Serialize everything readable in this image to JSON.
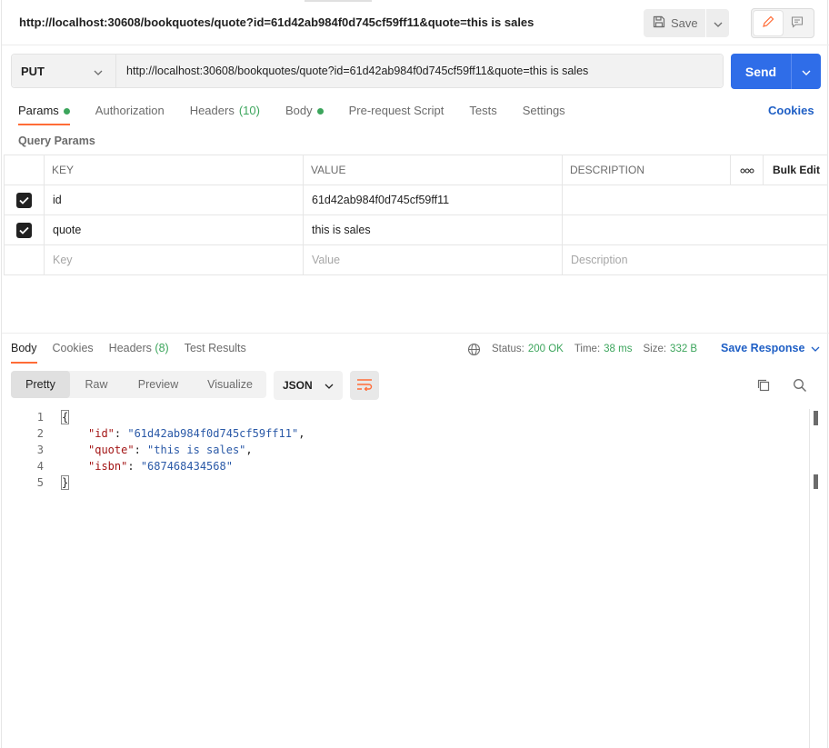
{
  "request": {
    "title": "http://localhost:30608/bookquotes/quote?id=61d42ab984f0d745cf59ff11&quote=this is sales",
    "method": "PUT",
    "url": "http://localhost:30608/bookquotes/quote?id=61d42ab984f0d745cf59ff11&quote=this is sales",
    "save_label": "Save",
    "send_label": "Send"
  },
  "request_tabs": [
    {
      "label": "Params",
      "active": true,
      "dot": true
    },
    {
      "label": "Authorization"
    },
    {
      "label": "Headers",
      "count": "(10)"
    },
    {
      "label": "Body",
      "dot": true
    },
    {
      "label": "Pre-request Script"
    },
    {
      "label": "Tests"
    },
    {
      "label": "Settings"
    }
  ],
  "cookies_label": "Cookies",
  "query_params": {
    "section_label": "Query Params",
    "columns": {
      "key": "KEY",
      "value": "VALUE",
      "description": "DESCRIPTION",
      "more": "ooo",
      "bulk_edit": "Bulk Edit"
    },
    "rows": [
      {
        "checked": true,
        "key": "id",
        "value": "61d42ab984f0d745cf59ff11",
        "description": ""
      },
      {
        "checked": true,
        "key": "quote",
        "value": "this is sales",
        "description": ""
      }
    ],
    "placeholders": {
      "key": "Key",
      "value": "Value",
      "description": "Description"
    }
  },
  "response": {
    "tabs": [
      {
        "label": "Body",
        "active": true
      },
      {
        "label": "Cookies"
      },
      {
        "label": "Headers",
        "count": "(8)"
      },
      {
        "label": "Test Results"
      }
    ],
    "status_label": "Status:",
    "status_value": "200 OK",
    "time_label": "Time:",
    "time_value": "38 ms",
    "size_label": "Size:",
    "size_value": "332 B",
    "save_response_label": "Save Response",
    "format_tabs": [
      "Pretty",
      "Raw",
      "Preview",
      "Visualize"
    ],
    "active_format": "Pretty",
    "language": "JSON",
    "code_lines": [
      {
        "n": "1",
        "text": "{"
      },
      {
        "n": "2",
        "key": "\"id\"",
        "value": "\"61d42ab984f0d745cf59ff11\"",
        "trail": ","
      },
      {
        "n": "3",
        "key": "\"quote\"",
        "value": "\"this is sales\"",
        "trail": ","
      },
      {
        "n": "4",
        "key": "\"isbn\"",
        "value": "\"687468434568\"",
        "trail": ""
      },
      {
        "n": "5",
        "text": "}"
      }
    ]
  },
  "colors": {
    "accent": "#ff6c37",
    "send": "#2f6de8",
    "link": "#1f5fc5",
    "ok": "#3ca55c"
  }
}
